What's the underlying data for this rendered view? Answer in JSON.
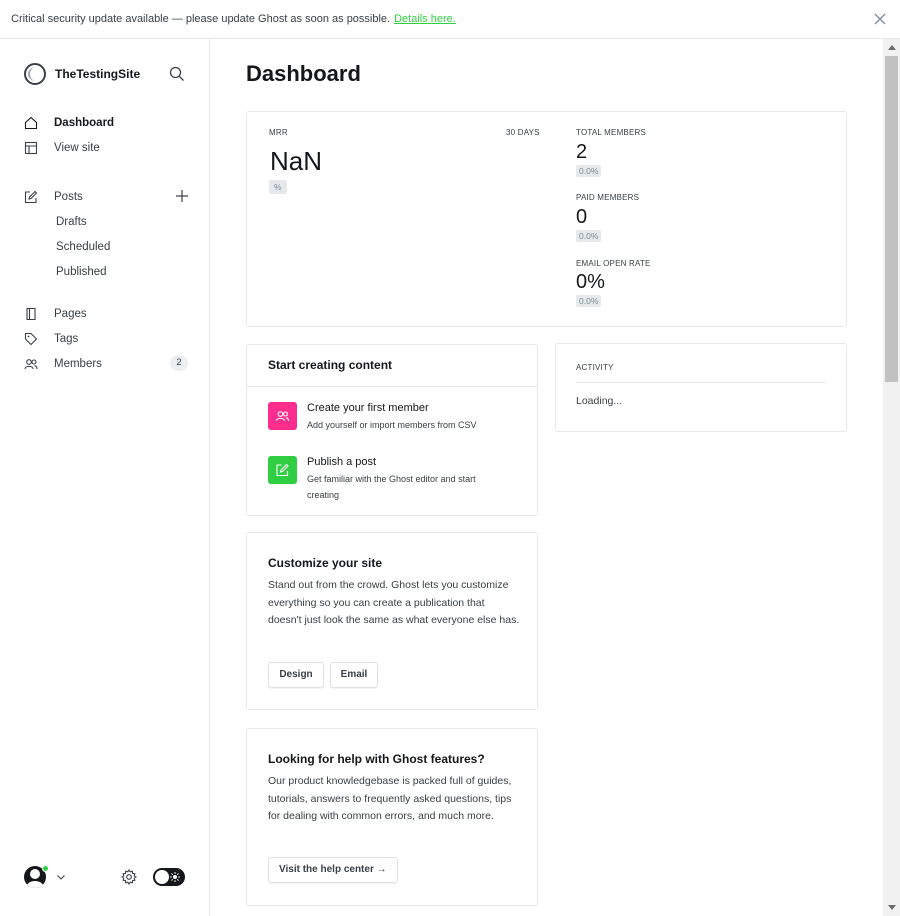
{
  "banner": {
    "text": "Critical security update available — please update Ghost as soon as possible.",
    "link_text": "Details here."
  },
  "sidebar": {
    "site_name": "TheTestingSite",
    "items": [
      {
        "label": "Dashboard",
        "icon": "home-icon"
      },
      {
        "label": "View site",
        "icon": "layout-icon"
      },
      {
        "label": "Posts",
        "icon": "edit-icon"
      },
      {
        "label": "Drafts"
      },
      {
        "label": "Scheduled"
      },
      {
        "label": "Published"
      },
      {
        "label": "Pages",
        "icon": "page-icon"
      },
      {
        "label": "Tags",
        "icon": "tag-icon"
      },
      {
        "label": "Members",
        "icon": "members-icon",
        "count": "2"
      }
    ]
  },
  "main": {
    "title": "Dashboard",
    "stats": {
      "mrr_label": "MRR",
      "period": "30 DAYS",
      "mrr_value": "NaN",
      "mrr_change": "%",
      "total_members_label": "TOTAL MEMBERS",
      "total_members_value": "2",
      "total_members_change": "0.0%",
      "paid_members_label": "PAID MEMBERS",
      "paid_members_value": "0",
      "paid_members_change": "0.0%",
      "email_open_rate_label": "EMAIL OPEN RATE",
      "email_open_rate_value": "0%",
      "email_open_rate_change": "0.0%"
    },
    "start_creating": {
      "title": "Start creating content",
      "items": [
        {
          "title": "Create your first member",
          "desc": "Add yourself or import members from CSV"
        },
        {
          "title": "Publish a post",
          "desc": "Get familiar with the Ghost editor and start creating"
        }
      ]
    },
    "activity": {
      "label": "ACTIVITY",
      "status": "Loading..."
    },
    "customize": {
      "title": "Customize your site",
      "text": "Stand out from the crowd. Ghost lets you customize everything so you can create a publication that doesn't just look the same as what everyone else has.",
      "design_label": "Design",
      "email_label": "Email"
    },
    "help": {
      "title": "Looking for help with Ghost features?",
      "text": "Our product knowledgebase is packed full of guides, tutorials, answers to frequently asked questions, tips for dealing with common errors, and much more.",
      "button_label": "Visit the help center →"
    }
  },
  "colors": {
    "accent_green": "#30cf43",
    "member_icon_bg": "#fb2d8d",
    "post_icon_bg": "#30cf43"
  }
}
